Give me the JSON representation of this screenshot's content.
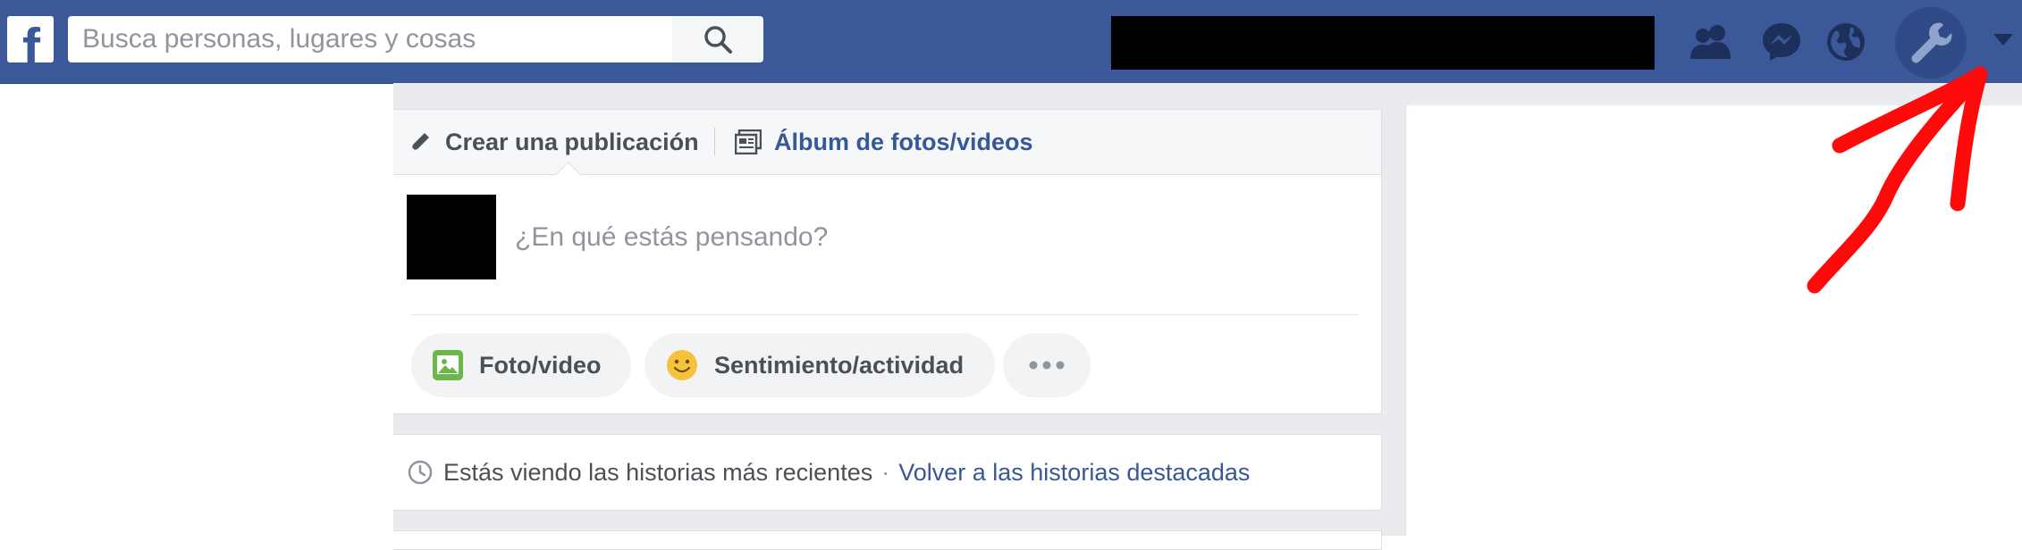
{
  "topbar": {
    "logo_letter": "f",
    "search": {
      "placeholder": "Busca personas, lugares y cosas",
      "value": ""
    },
    "icons": [
      "friends-icon",
      "messenger-icon",
      "globe-icon",
      "account-wrench-icon",
      "caret-down-icon"
    ],
    "colors": {
      "bar": "#3b5998",
      "redaction": "#000000"
    }
  },
  "composer": {
    "tabs": [
      {
        "label": "Crear una publicación",
        "icon": "pencil-icon"
      },
      {
        "label": "Álbum de fotos/videos",
        "icon": "album-icon"
      }
    ],
    "prompt": "¿En qué estás pensando?",
    "actions": [
      {
        "label": "Foto/video",
        "icon": "photo-icon"
      },
      {
        "label": "Sentimiento/actividad",
        "icon": "smiley-icon"
      },
      {
        "label": "",
        "icon": "more-dots-icon"
      }
    ]
  },
  "stories": {
    "text": "Estás viendo las historias más recientes",
    "separator": "·",
    "link": "Volver a las historias destacadas",
    "icon": "clock-icon"
  },
  "annotation": {
    "color": "#ff0000",
    "icon": "red-arrow-annotation"
  }
}
